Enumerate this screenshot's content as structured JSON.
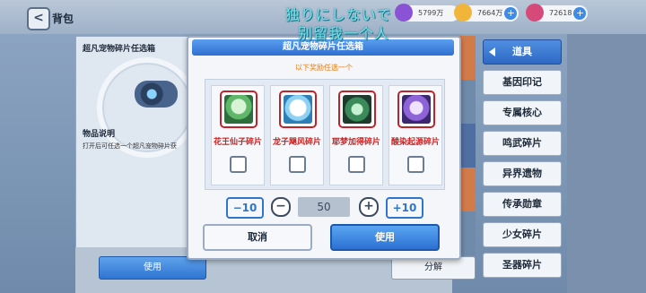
{
  "header": {
    "back_glyph": "<",
    "title": "背包",
    "overlay_line1": "独りにしないで",
    "overlay_line2": "别留我一个人"
  },
  "currencies": [
    {
      "icon": "power-icon",
      "value": "5799万",
      "color": "#8a53d6"
    },
    {
      "icon": "gold-coin-icon",
      "value": "7664万",
      "color": "#f0b53a"
    },
    {
      "icon": "gem-icon",
      "value": "72618",
      "color": "#d64a7a"
    }
  ],
  "left_panel": {
    "title": "超凡宠物碎片任选箱",
    "desc_title": "物品说明",
    "desc": "打开后可任选一个超凡宠物碎片获"
  },
  "bottom": {
    "use_label": "使用",
    "split_label": "分解"
  },
  "right_tabs": [
    {
      "label": "道具",
      "active": true
    },
    {
      "label": "基因印记"
    },
    {
      "label": "专属核心"
    },
    {
      "label": "鸣武碎片"
    },
    {
      "label": "异界遗物"
    },
    {
      "label": "传承勋章"
    },
    {
      "label": "少女碎片"
    },
    {
      "label": "圣器碎片"
    }
  ],
  "modal": {
    "title": "超凡宠物碎片任选箱",
    "subtitle": "以下奖励任选一个",
    "items": [
      {
        "name": "花王仙子碎片",
        "checked": false,
        "color": "#5fb86a"
      },
      {
        "name": "龙子飓风碎片",
        "checked": false,
        "color": "#8fd1f2"
      },
      {
        "name": "耶梦加得碎片",
        "checked": false,
        "color": "#3b8a5a"
      },
      {
        "name": "酸染起源碎片",
        "checked": false,
        "color": "#8f63d8"
      }
    ],
    "qty": {
      "minus10": "−10",
      "minus": "−",
      "value": "50",
      "plus": "+",
      "plus10": "+10"
    },
    "cancel_label": "取消",
    "confirm_label": "使用"
  }
}
